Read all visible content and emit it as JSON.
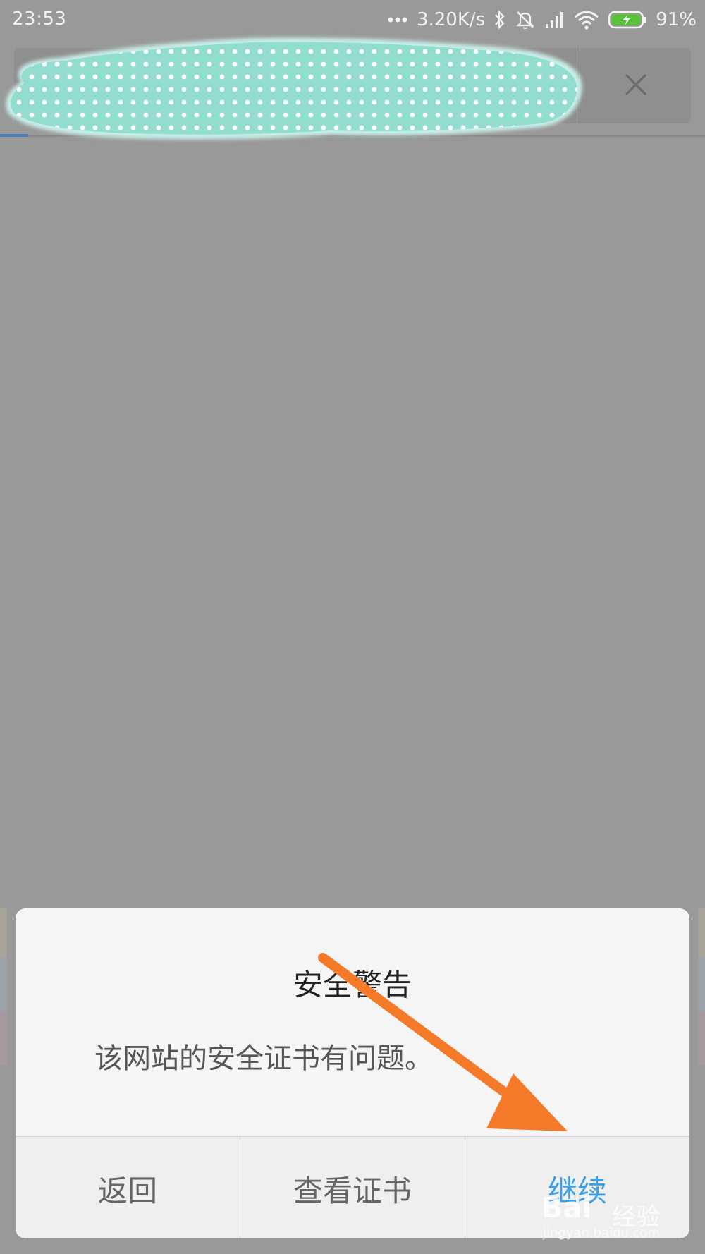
{
  "status_bar": {
    "time": "23:53",
    "network_speed": "3.20K/s",
    "battery_percent": "91%",
    "battery_color": "#58c23a",
    "icons": [
      "more-dots-icon",
      "bluetooth-icon",
      "mute-icon",
      "signal-icon",
      "wifi-icon",
      "battery-charging-icon"
    ]
  },
  "address_bar": {
    "close_icon": "close-icon"
  },
  "dialog": {
    "title": "安全警告",
    "message": "该网站的安全证书有问题。",
    "buttons": {
      "back": "返回",
      "view_certificate": "查看证书",
      "continue": "继续"
    },
    "accent_color": "#3a9ee8"
  },
  "annotation": {
    "arrow_color": "#f47a2a"
  },
  "watermark": {
    "brand": "Bai",
    "brand_suffix": "经验",
    "url": "jingyan.baidu.com"
  }
}
